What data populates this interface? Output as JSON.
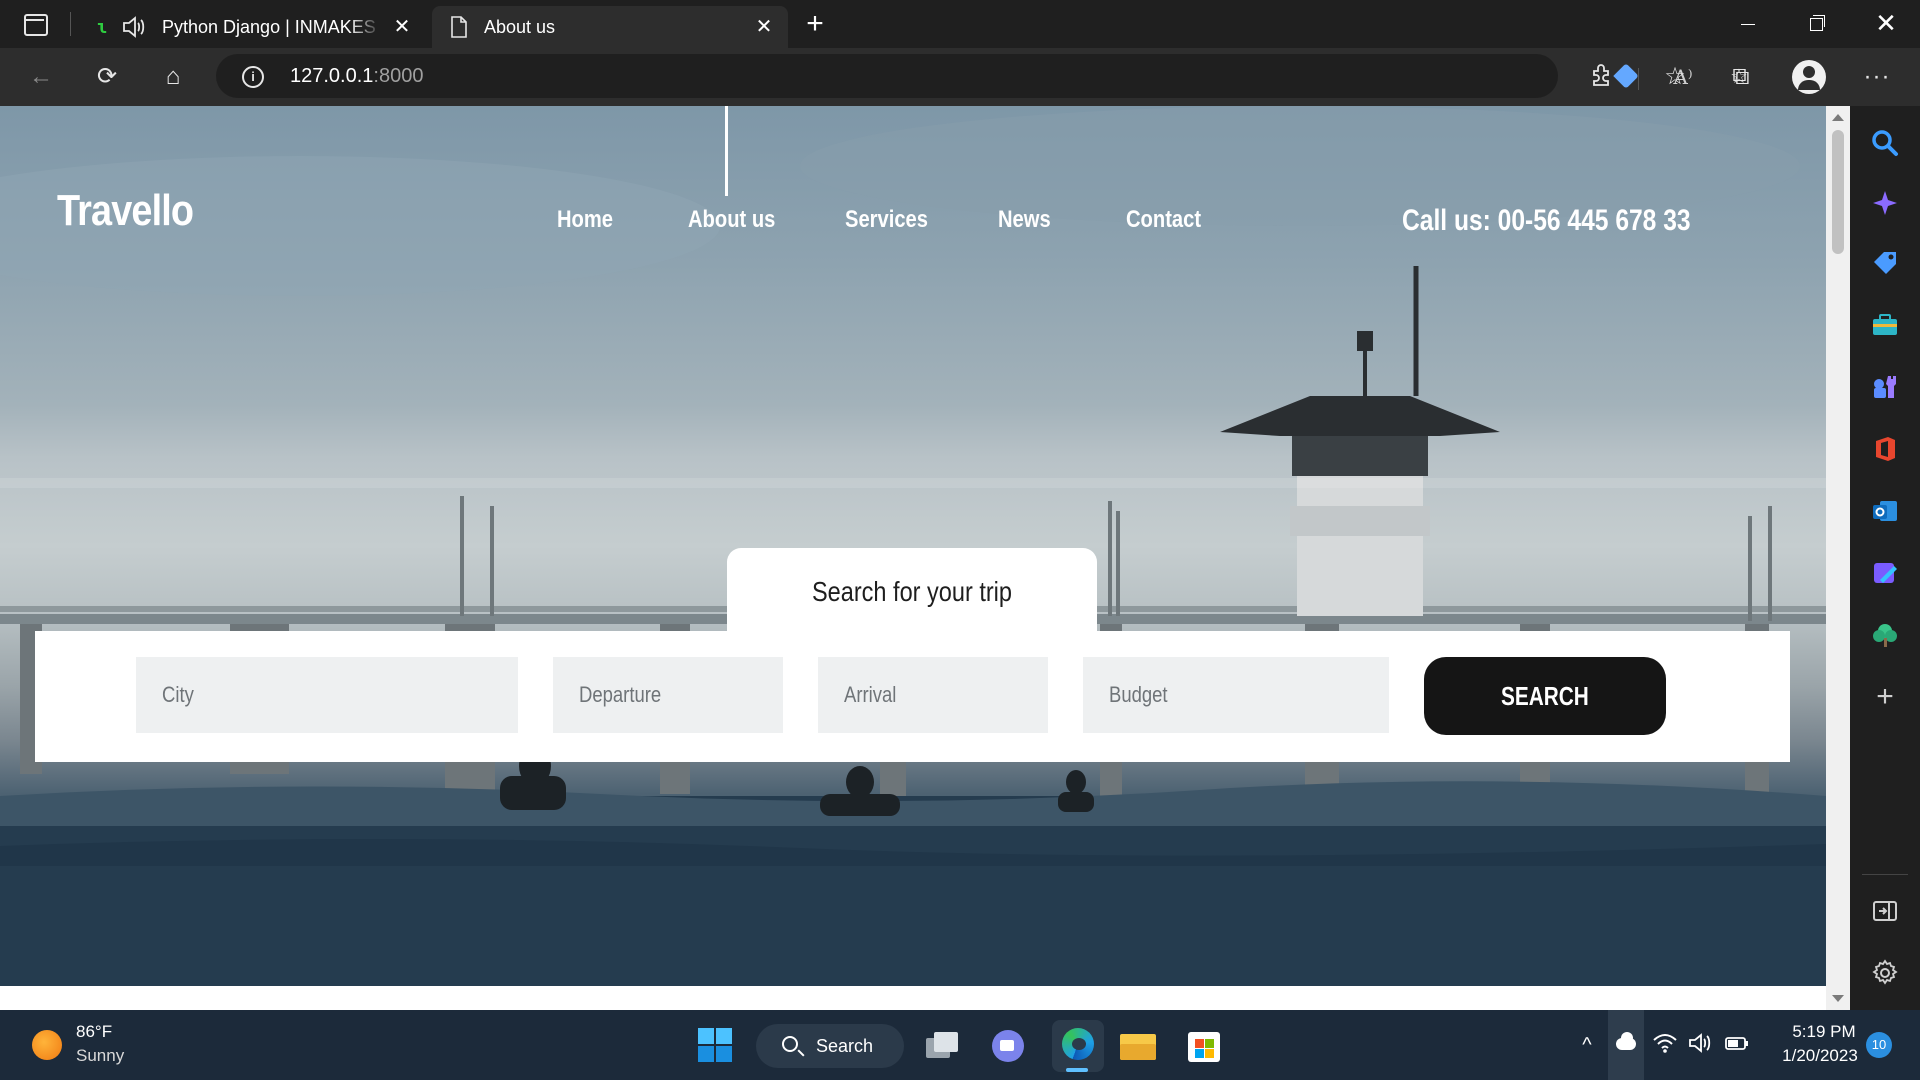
{
  "browser": {
    "tabs": [
      {
        "title": "Python Django | INMAKES L",
        "icon": "django-icon",
        "audio_icon": "speaker-icon",
        "active": false
      },
      {
        "title": "About us",
        "icon": "document-icon",
        "active": true
      }
    ],
    "address": {
      "host": "127.0.0.1",
      "port": ":8000"
    },
    "icons": {
      "tab_actions": "tab-actions-icon",
      "new_tab": "+",
      "back": "←",
      "reload": "⟳",
      "home": "⌂",
      "info": "i",
      "read_aloud": "A⁾",
      "add_favorite": "☆",
      "extensions": "⧉",
      "favorites": "☆",
      "collections": "⧉",
      "more": "···",
      "close": "✕"
    }
  },
  "site": {
    "brand": "Travello",
    "nav": [
      {
        "label": "Home"
      },
      {
        "label": "About us"
      },
      {
        "label": "Services"
      },
      {
        "label": "News"
      },
      {
        "label": "Contact"
      }
    ],
    "phone": "Call us: 00-56 445 678 33",
    "search": {
      "title": "Search for your trip",
      "fields": [
        {
          "placeholder": "City"
        },
        {
          "placeholder": "Departure"
        },
        {
          "placeholder": "Arrival"
        },
        {
          "placeholder": "Budget"
        }
      ],
      "button": "SEARCH"
    }
  },
  "sidebar": {
    "icons": [
      "search-icon",
      "copilot-icon",
      "shopping-icon",
      "tools-icon",
      "games-icon",
      "office-icon",
      "outlook-icon",
      "designer-icon",
      "tree-icon",
      "add-icon",
      "hide-sidebar-icon",
      "settings-icon"
    ],
    "add": "+"
  },
  "taskbar": {
    "weather": {
      "temp": "86°F",
      "condition": "Sunny"
    },
    "search_label": "Search",
    "clock": {
      "time": "5:19 PM",
      "date": "1/20/2023"
    },
    "notifications": "10",
    "tray": {
      "chevron": "^",
      "wifi": "wifi-icon",
      "volume": "volume-icon",
      "battery": "battery-icon"
    }
  },
  "colors": {
    "chrome_dark": "#1f1f1f",
    "toolbar": "#2d2d2d",
    "search_button": "#151515",
    "field_bg": "#eef0f1",
    "taskbar": "#1c2a3a"
  }
}
